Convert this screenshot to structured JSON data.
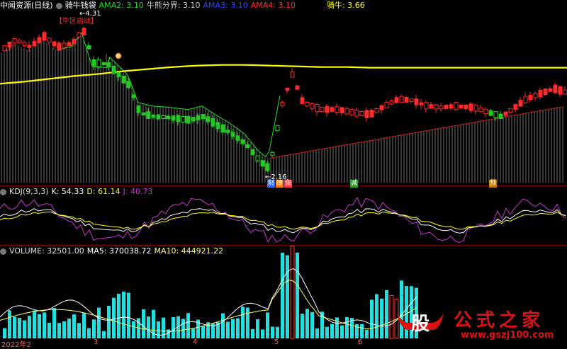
{
  "colors": {
    "up": "#ff3232",
    "down": "#22e0e0",
    "bull": "#ff2a2a",
    "bear": "#22c922",
    "ama": "#ffff00",
    "ama2": "#22dd22",
    "ama3": "#3344ff",
    "cloud": "#c8c8c8",
    "k": "#ffffff",
    "d": "#ffff00",
    "j": "#cc33cc",
    "ma5": "#ffffff",
    "ma10": "#ffff66"
  },
  "header_main": {
    "title": "中闻资源(日线)",
    "indicator": "骑牛钱袋",
    "ama2": "AMA2: 3.10",
    "split": "牛熊分界: 3.10",
    "ama3": "AMA3: 3.10",
    "ama4": "AMA4: 3.10",
    "bull": "骑牛: 3.66"
  },
  "header_kdj": {
    "name": "KDJ(9,3,3)",
    "k": "K: 54.33",
    "d": "D: 61.14",
    "j": "J: 40.73"
  },
  "header_vol": {
    "name": "VOLUME: 32501.00",
    "ma5": "MA5: 370038.72",
    "ma10": "MA10: 444921.22"
  },
  "annotations": {
    "high_label": "←4.31",
    "low_label": "←2.16",
    "signal": "【牛区启动】",
    "flags": [
      {
        "text": "财",
        "color": "#2b6bff"
      },
      {
        "text": "榜",
        "color": "#ff7a00"
      },
      {
        "text": "涨",
        "color": "#ff3b3b"
      },
      {
        "text": "减",
        "color": "#2a9a2a"
      },
      {
        "text": "预",
        "color": "#c07a00"
      }
    ]
  },
  "x_axis": [
    "2022年2",
    "3",
    "4",
    "5",
    "6"
  ],
  "watermark": {
    "glyph": "股",
    "text": "公式之家",
    "url": "www.gszj100.com"
  },
  "chart_data": [
    {
      "type": "candlestick",
      "title": "中闻资源(日线)",
      "price_range": [
        2.16,
        4.31
      ],
      "series": [
        {
          "name": "AMA",
          "values": [
            3.42,
            3.45,
            3.49,
            3.53,
            3.56,
            3.6,
            3.63,
            3.66,
            3.68,
            3.69,
            3.69,
            3.68,
            3.67,
            3.66,
            3.66,
            3.65,
            3.65,
            3.65,
            3.65,
            3.65,
            3.65,
            3.65,
            3.65,
            3.65
          ]
        },
        {
          "name": "骑牛",
          "values": [
            3.66
          ]
        }
      ],
      "annotations": [
        "←4.31",
        "←2.16",
        "【牛区启动】"
      ]
    },
    {
      "type": "line",
      "title": "KDJ(9,3,3)",
      "series": [
        {
          "name": "K",
          "last": 54.33
        },
        {
          "name": "D",
          "last": 61.14
        },
        {
          "name": "J",
          "last": 40.73
        }
      ]
    },
    {
      "type": "bar",
      "title": "VOLUME",
      "series": [
        {
          "name": "VOLUME",
          "last": 32501.0
        },
        {
          "name": "MA5",
          "last": 370038.72
        },
        {
          "name": "MA10",
          "last": 444921.22
        }
      ]
    }
  ]
}
